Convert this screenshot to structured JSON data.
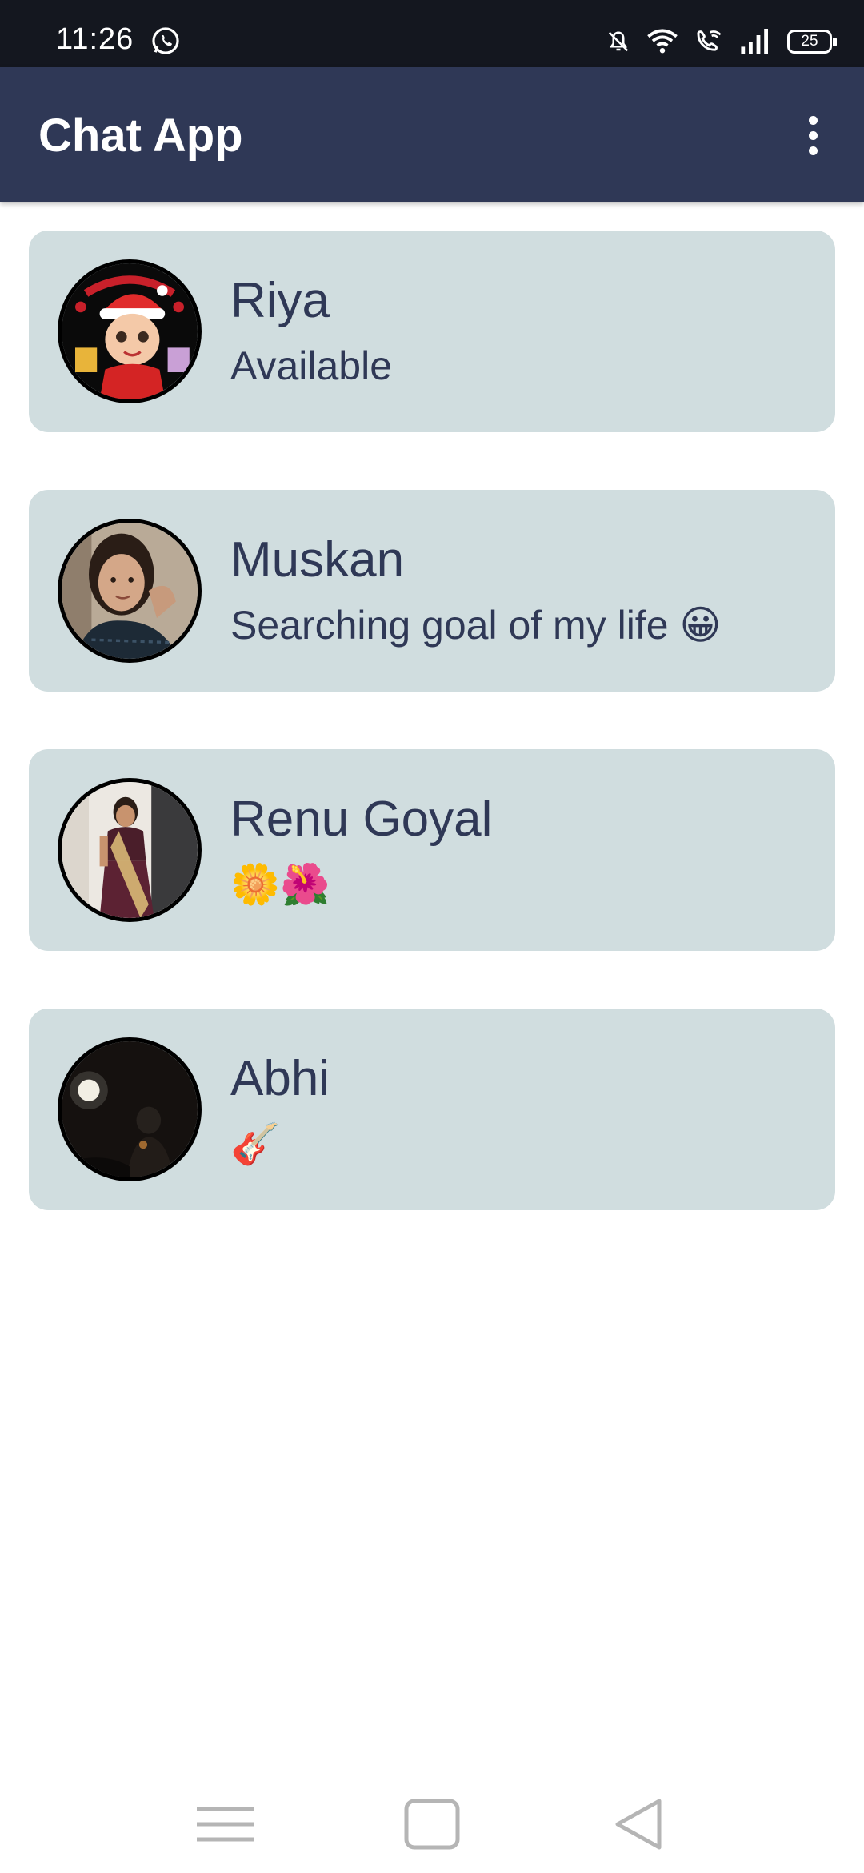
{
  "status_bar": {
    "time": "11:26",
    "battery": "25",
    "icons": [
      "whatsapp-icon",
      "bell-off-icon",
      "wifi-icon",
      "wifi-call-icon",
      "signal-icon",
      "battery-icon"
    ]
  },
  "app_bar": {
    "title": "Chat App",
    "menu_icon": "more-vert-icon"
  },
  "chats": [
    {
      "name": "Riya",
      "status": "Available"
    },
    {
      "name": "Muskan",
      "status": "Searching goal of my life 😀"
    },
    {
      "name": "Renu Goyal",
      "status": "🌼🌺"
    },
    {
      "name": "Abhi",
      "status": "🎸"
    }
  ],
  "nav_bar": {
    "icons": [
      "menu-icon",
      "home-icon",
      "back-icon"
    ]
  },
  "colors": {
    "app_bar": "#2f3856",
    "card": "#d0dddf",
    "text": "#2f3856",
    "status_bar": "#14171f"
  }
}
